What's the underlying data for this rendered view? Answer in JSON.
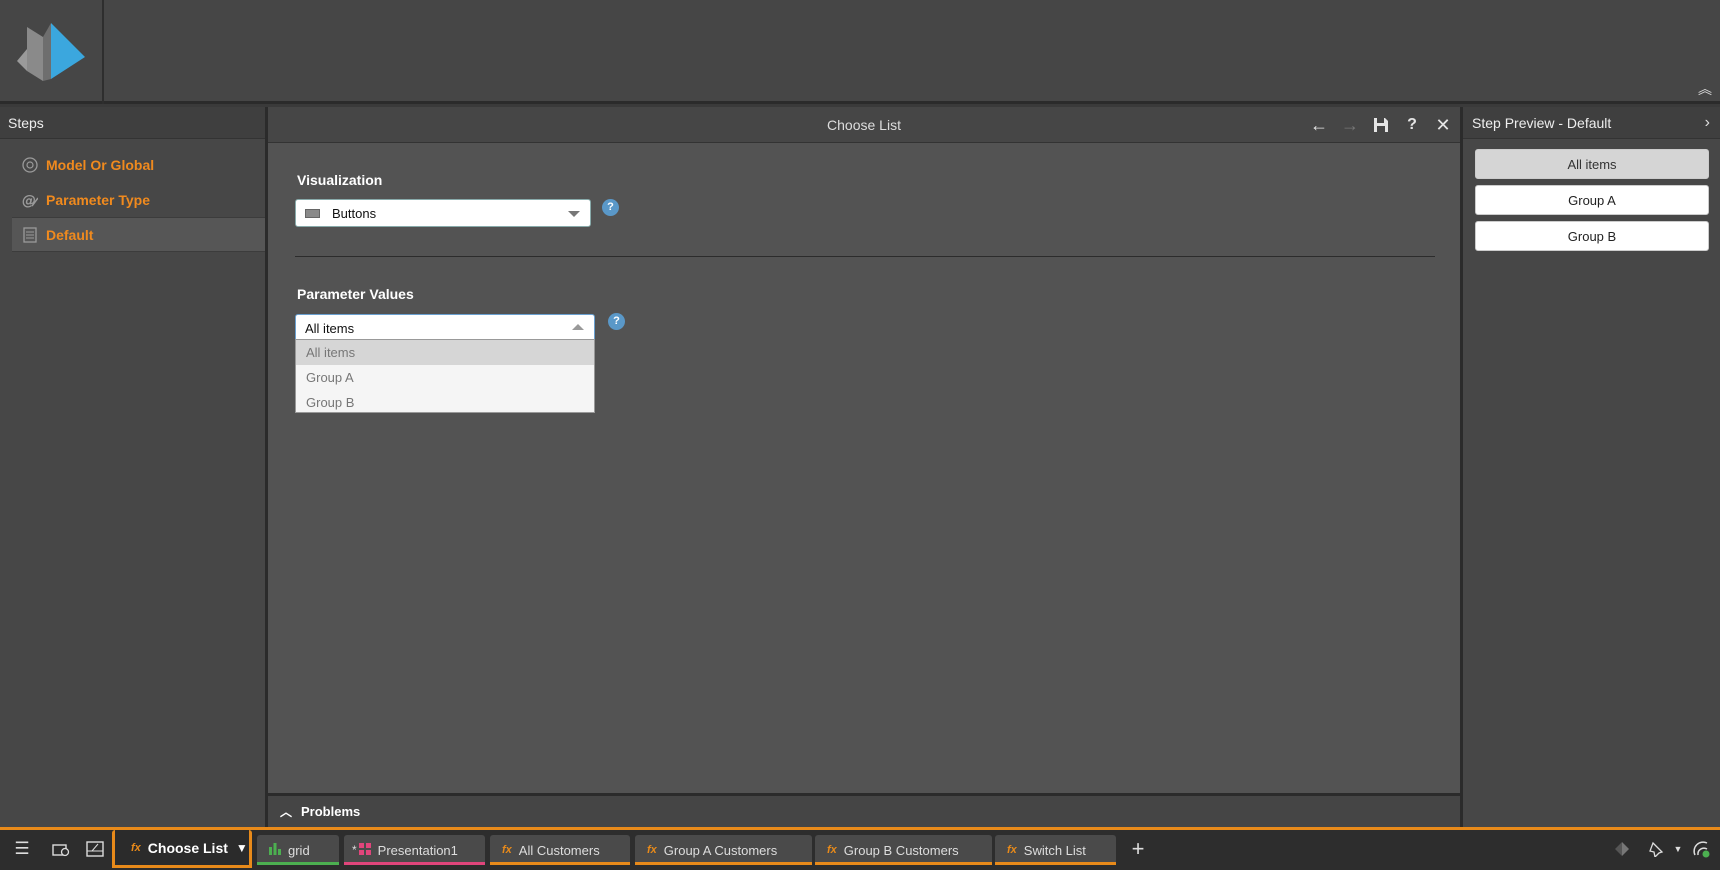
{
  "steps_panel": {
    "title": "Steps",
    "items": [
      {
        "label": "Model Or Global",
        "icon": "globe-icon"
      },
      {
        "label": "Parameter Type",
        "icon": "at-pencil-icon"
      },
      {
        "label": "Default",
        "icon": "calculator-icon"
      }
    ]
  },
  "main": {
    "title": "Choose List",
    "visualization_label": "Visualization",
    "visualization_value": "Buttons",
    "parameter_values_label": "Parameter Values",
    "parameter_values_value": "All items",
    "dropdown_options": [
      "All items",
      "Group A",
      "Group B"
    ],
    "help_glyph": "?",
    "problems_label": "Problems"
  },
  "preview": {
    "title": "Step Preview - Default",
    "buttons": [
      "All items",
      "Group A",
      "Group B"
    ]
  },
  "taskbar": {
    "active_tab": "Choose List",
    "tabs": [
      {
        "label": "grid",
        "icon": "bar-chart-icon",
        "color": "#4caf50"
      },
      {
        "label": "Presentation1",
        "icon": "presentation-icon",
        "color": "#e0457b",
        "modified": "*"
      },
      {
        "label": "All Customers",
        "icon": "fx-icon",
        "color": "#e88a1a"
      },
      {
        "label": "Group A Customers",
        "icon": "fx-icon",
        "color": "#e88a1a"
      },
      {
        "label": "Group B Customers",
        "icon": "fx-icon",
        "color": "#e88a1a"
      },
      {
        "label": "Switch List",
        "icon": "fx-icon",
        "color": "#e88a1a"
      }
    ]
  },
  "colors": {
    "accent_orange": "#e88a1a",
    "help_blue": "#5a98c8",
    "logo_blue": "#3ba7de"
  }
}
